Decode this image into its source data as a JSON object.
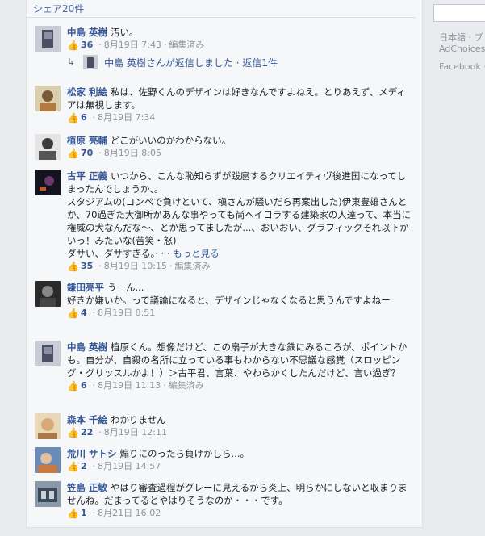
{
  "share_count": "シェア20件",
  "comments": [
    {
      "author": "中島 英樹",
      "text": "汚い。",
      "likes": "36",
      "date": "8月19日 7:43",
      "edited": "編集済み",
      "reply": "中島 英樹さんが返信しました · 返信1件"
    },
    {
      "author": "松家 利絵",
      "text": "私は、佐野くんのデザインは好きなんですよねえ。とりあえず、メディアは無視します。",
      "likes": "6",
      "date": "8月19日 7:34"
    },
    {
      "author": "植原 亮輔",
      "text": "どこがいいのかわからない。",
      "likes": "70",
      "date": "8月19日 8:05"
    },
    {
      "author": "古平 正義",
      "text_lines": [
        "いつから、こんな恥知らずが跋扈するクリエイティヴ後進国になってしまったんでしょうか、。",
        "スタジアムの(コンペで負けといて、槇さんが騒いだら再案出した)伊東豊雄さんとか、70過ぎた大御所があんな事やっても尚ヘイコラする建築家の人達って、本当に権威の犬なんだな〜、とか思ってましたが...、おいおい、グラフィックそれ以下かいっ！みたいな(苦笑・怒)",
        "ダサい、ダサすぎる。· · ·"
      ],
      "more": "もっと見る",
      "likes": "35",
      "date": "8月19日 10:15",
      "edited": "編集済み"
    },
    {
      "author": "鎌田亮平",
      "text": "うーん...\n好きか嫌いか。って議論になると、デザインじゃなくなると思うんですよねー",
      "likes": "4",
      "date": "8月19日 8:51"
    },
    {
      "author": "中島 英樹",
      "text": "植原くん。想像だけど、この扇子が大きな鉄にみるころが、ポイントかも。自分が、自殺の名所に立っている事もわからない不思議な感覚（スロッピング・グリッスルかよ！）＞古平君、言葉、やわらかくしたんだけど、言い過ぎ？",
      "likes": "6",
      "date": "8月19日 11:13",
      "edited": "編集済み"
    },
    {
      "author": "森本 千絵",
      "text": "わかりません",
      "likes": "22",
      "date": "8月19日 12:11"
    },
    {
      "author": "荒川 サトシ",
      "text": "煽りにのったら負けかしら...。",
      "likes": "2",
      "date": "8月19日 14:57"
    },
    {
      "author": "笠島 正敏",
      "text": "やはり審査過程がグレーに見えるから炎上、明らかにしないと収まりませんね。だまってるとやはりそうなのか・・・です。",
      "likes": "1",
      "date": "8月21日 16:02"
    }
  ],
  "right_column": {
    "lang": "日本語 · ブ",
    "adchoices": "AdChoices",
    "footer": "Facebook ©"
  },
  "icons": {
    "like": "thumbs-up-icon",
    "reply": "reply-arrow-icon"
  },
  "colors": {
    "link": "#365899",
    "meta": "#90949c",
    "like": "#4267b2"
  }
}
